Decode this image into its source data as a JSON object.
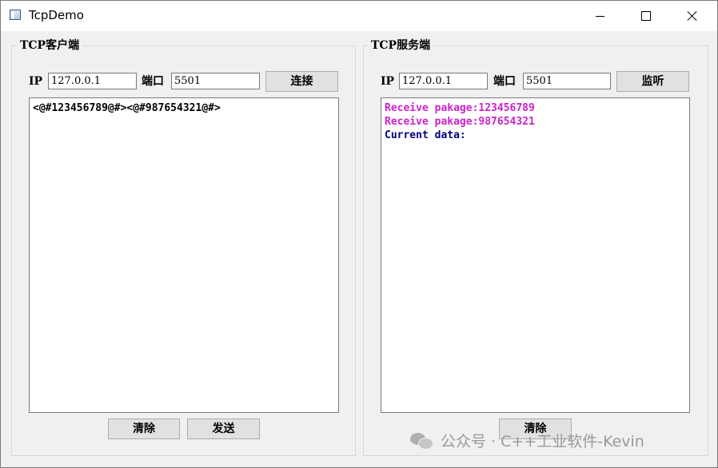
{
  "window": {
    "title": "TcpDemo"
  },
  "client": {
    "group_title": "TCP客户端",
    "ip_label": "IP",
    "ip_value": "127.0.0.1",
    "port_label": "端口",
    "port_value": "5501",
    "connect_label": "连接",
    "log": "<@#123456789@#><@#987654321@#>",
    "clear_label": "清除",
    "send_label": "发送"
  },
  "server": {
    "group_title": "TCP服务端",
    "ip_label": "IP",
    "ip_value": "127.0.0.1",
    "port_label": "端口",
    "port_value": "5501",
    "listen_label": "监听",
    "log_lines": [
      {
        "text": "Receive pakage:123456789",
        "color": "#cc22cc"
      },
      {
        "text": "Receive pakage:987654321",
        "color": "#cc22cc"
      },
      {
        "text": "Current data:",
        "color": "#000080"
      }
    ],
    "clear_label": "清除"
  },
  "watermark": {
    "text": "公众号 · C++工业软件-Kevin"
  }
}
